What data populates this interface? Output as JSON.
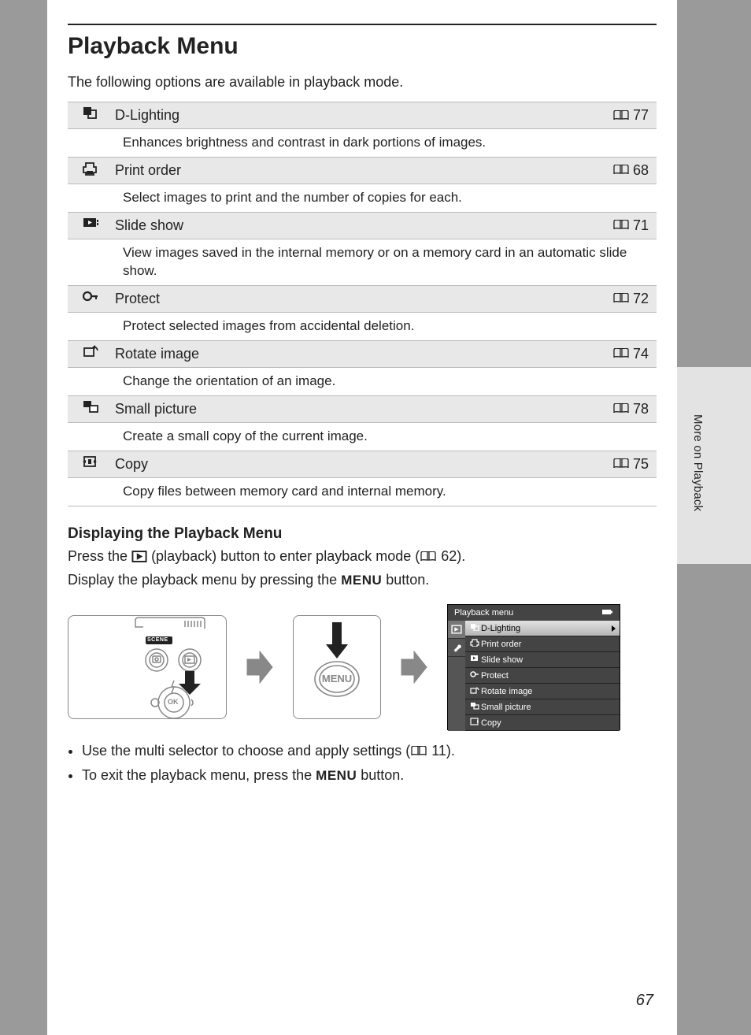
{
  "thumbTab": "More on Playback",
  "heading": "Playback Menu",
  "intro": "The following options are available in playback mode.",
  "options": [
    {
      "label": "D-Lighting",
      "page": "77",
      "desc": "Enhances brightness and contrast in dark portions of images."
    },
    {
      "label": "Print order",
      "page": "68",
      "desc": "Select images to print and the number of copies for each."
    },
    {
      "label": "Slide show",
      "page": "71",
      "desc": "View images saved in the internal memory or on a memory card in an automatic slide show."
    },
    {
      "label": "Protect",
      "page": "72",
      "desc": "Protect selected images from accidental deletion."
    },
    {
      "label": "Rotate image",
      "page": "74",
      "desc": "Change the orientation of an image."
    },
    {
      "label": "Small picture",
      "page": "78",
      "desc": "Create a small copy of the current image."
    },
    {
      "label": "Copy",
      "page": "75",
      "desc": "Copy files between memory card and internal memory."
    }
  ],
  "subHeading": "Displaying the Playback Menu",
  "para1_a": "Press the ",
  "para1_b": " (playback) button to enter playback mode (",
  "para1_ref": "62",
  "para1_c": ").",
  "para2_a": "Display the playback menu by pressing the ",
  "menuWord": "MENU",
  "para2_b": " button.",
  "cameraLabels": {
    "scene": "SCENE",
    "ok": "OK",
    "menu": "MENU"
  },
  "lcd": {
    "title": "Playback menu",
    "items": [
      "D-Lighting",
      "Print order",
      "Slide show",
      "Protect",
      "Rotate image",
      "Small picture",
      "Copy"
    ]
  },
  "bullets": [
    {
      "a": "Use the multi selector to choose and apply settings (",
      "ref": "11",
      "b": ")."
    },
    {
      "a": "To exit the playback menu, press the ",
      "menu": "MENU",
      "b": " button."
    }
  ],
  "pageNumber": "67"
}
